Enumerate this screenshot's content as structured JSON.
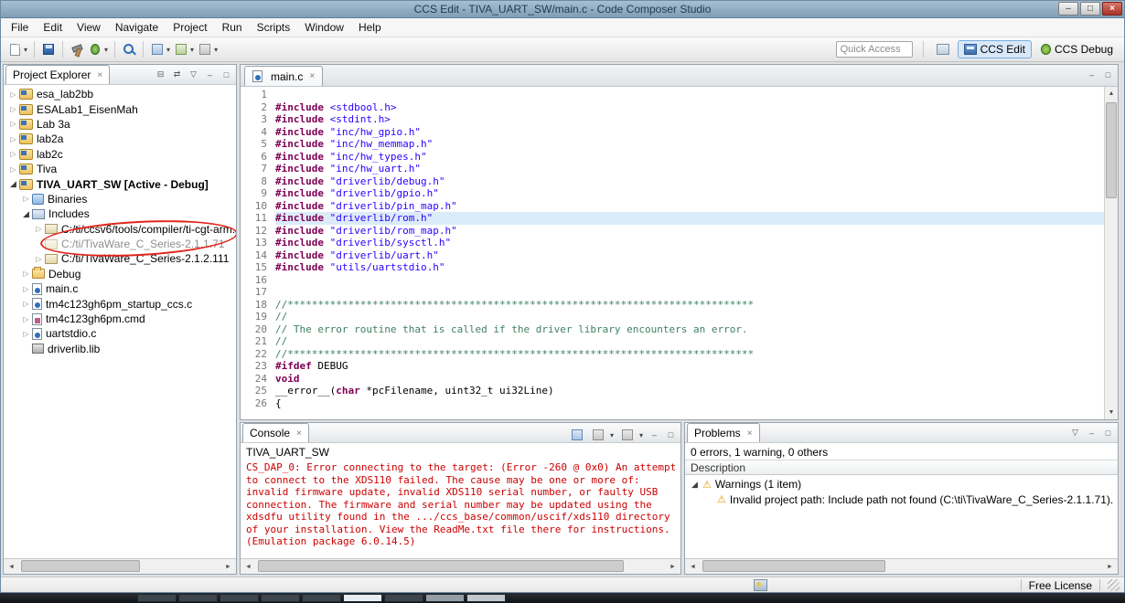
{
  "window": {
    "title": "CCS Edit - TIVA_UART_SW/main.c - Code Composer Studio",
    "controls": {
      "minimize": "–",
      "maximize": "□",
      "close": "×"
    }
  },
  "menu_bar": {
    "items": [
      "File",
      "Edit",
      "View",
      "Navigate",
      "Project",
      "Run",
      "Scripts",
      "Window",
      "Help"
    ]
  },
  "toolbar": {
    "quick_access_placeholder": "Quick Access",
    "perspectives": [
      {
        "label": "CCS Edit",
        "active": true
      },
      {
        "label": "CCS Debug",
        "active": false
      }
    ]
  },
  "icons": {
    "close": "×",
    "menu_arrow": "▾",
    "view_menu": "▽",
    "minimize": "–",
    "maximize": "□",
    "collapsed_arrow": "▷",
    "expanded_arrow": "◢",
    "scroll_up": "▲",
    "scroll_down": "▼",
    "scroll_left": "◄",
    "scroll_right": "►",
    "warning": "⚠",
    "collapse_all": "⊟",
    "link_editor": "⇄"
  },
  "project_explorer": {
    "title": "Project Explorer",
    "tree": [
      {
        "label": "esa_lab2bb",
        "level": 0,
        "arrow": "collapsed",
        "icon": "project"
      },
      {
        "label": "ESALab1_EisenMah",
        "level": 0,
        "arrow": "collapsed",
        "icon": "project"
      },
      {
        "label": "Lab 3a",
        "level": 0,
        "arrow": "collapsed",
        "icon": "project"
      },
      {
        "label": "lab2a",
        "level": 0,
        "arrow": "collapsed",
        "icon": "project"
      },
      {
        "label": "lab2c",
        "level": 0,
        "arrow": "collapsed",
        "icon": "project"
      },
      {
        "label": "Tiva",
        "level": 0,
        "arrow": "collapsed",
        "icon": "project"
      },
      {
        "label": "TIVA_UART_SW [Active - Debug]",
        "level": 0,
        "arrow": "expanded",
        "icon": "project",
        "bold": true
      },
      {
        "label": "Binaries",
        "level": 1,
        "arrow": "collapsed",
        "icon": "binaries"
      },
      {
        "label": "Includes",
        "level": 1,
        "arrow": "expanded",
        "icon": "includes"
      },
      {
        "label": "C:/ti/ccsv6/tools/compiler/ti-cgt-arm...",
        "level": 2,
        "arrow": "collapsed",
        "icon": "incpath"
      },
      {
        "label": "C:/ti/TivaWare_C_Series-2.1.1.71",
        "level": 2,
        "arrow": "none",
        "icon": "incpath",
        "dim": true
      },
      {
        "label": "C:/ti/TivaWare_C_Series-2.1.2.111",
        "level": 2,
        "arrow": "collapsed",
        "icon": "incpath"
      },
      {
        "label": "Debug",
        "level": 1,
        "arrow": "collapsed",
        "icon": "folder"
      },
      {
        "label": "main.c",
        "level": 1,
        "arrow": "collapsed",
        "icon": "cfile"
      },
      {
        "label": "tm4c123gh6pm_startup_ccs.c",
        "level": 1,
        "arrow": "collapsed",
        "icon": "cfile"
      },
      {
        "label": "tm4c123gh6pm.cmd",
        "level": 1,
        "arrow": "collapsed",
        "icon": "cmdfile"
      },
      {
        "label": "uartstdio.c",
        "level": 1,
        "arrow": "collapsed",
        "icon": "cfile"
      },
      {
        "label": "driverlib.lib",
        "level": 1,
        "arrow": "none",
        "icon": "lib"
      }
    ]
  },
  "editor": {
    "tab": "main.c",
    "lines": [
      {
        "n": "1",
        "t": []
      },
      {
        "n": "2",
        "t": [
          [
            "d",
            "#include"
          ],
          [
            "p",
            " "
          ],
          [
            "s",
            "<stdbool.h>"
          ]
        ]
      },
      {
        "n": "3",
        "t": [
          [
            "d",
            "#include"
          ],
          [
            "p",
            " "
          ],
          [
            "s",
            "<stdint.h>"
          ]
        ]
      },
      {
        "n": "4",
        "t": [
          [
            "d",
            "#include"
          ],
          [
            "p",
            " "
          ],
          [
            "s",
            "\"inc/hw_gpio.h\""
          ]
        ]
      },
      {
        "n": "5",
        "t": [
          [
            "d",
            "#include"
          ],
          [
            "p",
            " "
          ],
          [
            "s",
            "\"inc/hw_memmap.h\""
          ]
        ]
      },
      {
        "n": "6",
        "t": [
          [
            "d",
            "#include"
          ],
          [
            "p",
            " "
          ],
          [
            "s",
            "\"inc/hw_types.h\""
          ]
        ]
      },
      {
        "n": "7",
        "t": [
          [
            "d",
            "#include"
          ],
          [
            "p",
            " "
          ],
          [
            "s",
            "\"inc/hw_uart.h\""
          ]
        ]
      },
      {
        "n": "8",
        "t": [
          [
            "d",
            "#include"
          ],
          [
            "p",
            " "
          ],
          [
            "s",
            "\"driverlib/debug.h\""
          ]
        ]
      },
      {
        "n": "9",
        "t": [
          [
            "d",
            "#include"
          ],
          [
            "p",
            " "
          ],
          [
            "s",
            "\"driverlib/gpio.h\""
          ]
        ]
      },
      {
        "n": "10",
        "t": [
          [
            "d",
            "#include"
          ],
          [
            "p",
            " "
          ],
          [
            "s",
            "\"driverlib/pin_map.h\""
          ]
        ]
      },
      {
        "n": "11",
        "hl": true,
        "t": [
          [
            "d",
            "#include"
          ],
          [
            "p",
            " "
          ],
          [
            "s",
            "\"driverlib/rom.h\""
          ]
        ]
      },
      {
        "n": "12",
        "t": [
          [
            "d",
            "#include"
          ],
          [
            "p",
            " "
          ],
          [
            "s",
            "\"driverlib/rom_map.h\""
          ]
        ]
      },
      {
        "n": "13",
        "t": [
          [
            "d",
            "#include"
          ],
          [
            "p",
            " "
          ],
          [
            "s",
            "\"driverlib/sysctl.h\""
          ]
        ]
      },
      {
        "n": "14",
        "t": [
          [
            "d",
            "#include"
          ],
          [
            "p",
            " "
          ],
          [
            "s",
            "\"driverlib/uart.h\""
          ]
        ]
      },
      {
        "n": "15",
        "t": [
          [
            "d",
            "#include"
          ],
          [
            "p",
            " "
          ],
          [
            "s",
            "\"utils/uartstdio.h\""
          ]
        ]
      },
      {
        "n": "16",
        "t": []
      },
      {
        "n": "17",
        "t": []
      },
      {
        "n": "18",
        "t": [
          [
            "c",
            "//*****************************************************************************"
          ]
        ]
      },
      {
        "n": "19",
        "t": [
          [
            "c",
            "//"
          ]
        ]
      },
      {
        "n": "20",
        "t": [
          [
            "c",
            "// The error routine that is called if the driver library encounters an error."
          ]
        ]
      },
      {
        "n": "21",
        "t": [
          [
            "c",
            "//"
          ]
        ]
      },
      {
        "n": "22",
        "t": [
          [
            "c",
            "//*****************************************************************************"
          ]
        ]
      },
      {
        "n": "23",
        "t": [
          [
            "d",
            "#ifdef"
          ],
          [
            "p",
            " DEBUG"
          ]
        ]
      },
      {
        "n": "24",
        "t": [
          [
            "k",
            "void"
          ]
        ]
      },
      {
        "n": "25",
        "t": [
          [
            "p",
            "__error__("
          ],
          [
            "k",
            "char"
          ],
          [
            "p",
            " *pcFilename, uint32_t ui32Line)"
          ]
        ]
      },
      {
        "n": "26",
        "t": [
          [
            "p",
            "{"
          ]
        ]
      }
    ]
  },
  "console": {
    "tab": "Console",
    "title": "TIVA_UART_SW",
    "text_color": "#cc0000",
    "lines": [
      "CS_DAP_0: Error connecting to the target: (Error -260 @ 0x0) An attempt",
      "to connect to the XDS110 failed. The cause may be one or more of:",
      "invalid firmware update, invalid XDS110 serial number, or faulty USB",
      "connection. The firmware and serial number may be updated using the",
      "xdsdfu utility found in the .../ccs_base/common/uscif/xds110 directory",
      "of your installation. View the ReadMe.txt file there for instructions.",
      "(Emulation package 6.0.14.5)"
    ]
  },
  "problems": {
    "tab": "Problems",
    "summary": "0 errors, 1 warning, 0 others",
    "column_header": "Description",
    "rows": [
      {
        "label": "Warnings (1 item)",
        "level": 0,
        "arrow": "expanded",
        "icon": "warning"
      },
      {
        "label": "Invalid project path: Include path not found (C:\\ti\\TivaWare_C_Series-2.1.1.71).",
        "level": 1,
        "arrow": "none",
        "icon": "warning"
      }
    ]
  },
  "status_bar": {
    "license": "Free License"
  }
}
